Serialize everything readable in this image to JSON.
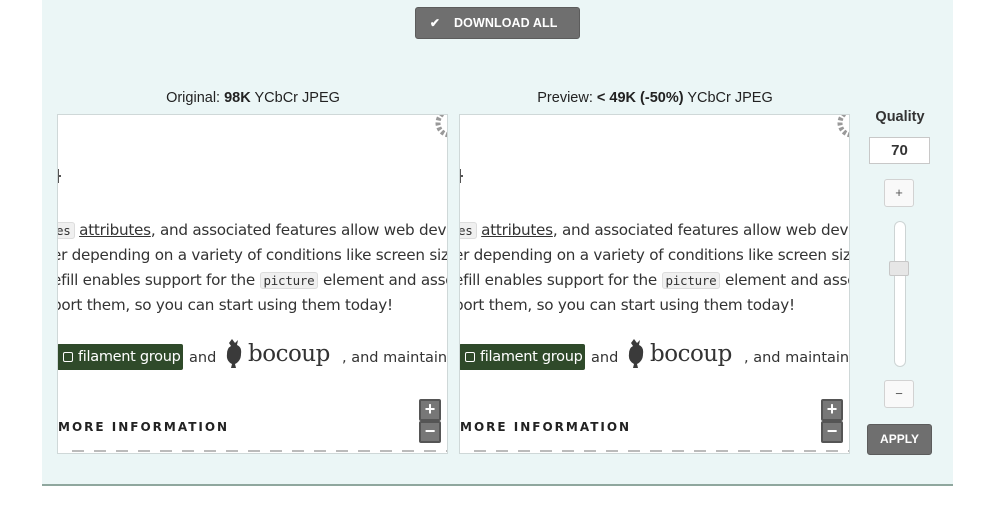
{
  "toolbar": {
    "download_label": "DOWNLOAD ALL",
    "download_icon": "check-icon"
  },
  "original": {
    "prefix": "Original: ",
    "size": "98K",
    "format": " YCbCr JPEG"
  },
  "preview": {
    "prefix": "Preview: ",
    "size": "< 49K (-50%)",
    "format": " YCbCr JPEG"
  },
  "content": {
    "line1_code": "es",
    "line1_link": "attributes",
    "line1_rest": ", and associated features allow web develop",
    "line2": "er depending on a variety of conditions like screen size, v",
    "line3_pre": "efill enables support for the ",
    "line3_code": "picture",
    "line3_post": " element and associ",
    "line4": "port them, so you can start using them today!",
    "badge": "filament group",
    "and": "and",
    "bocoup": "bocoup",
    "maintained": ", and maintained",
    "heading": "MORE INFORMATION"
  },
  "zoom": {
    "in_label": "+",
    "out_label": "−"
  },
  "quality": {
    "label": "Quality",
    "value": "70",
    "increase_label": "+",
    "decrease_label": "−",
    "slider_level": 0.7,
    "apply_label": "APPLY"
  },
  "colors": {
    "panel_bg": "#ebf6f6",
    "button_bg": "#6f6f6f",
    "badge_bg": "#2f4a2a"
  }
}
